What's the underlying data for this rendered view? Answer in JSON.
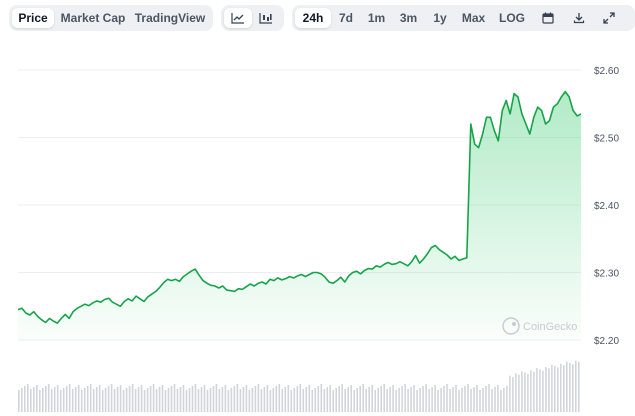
{
  "tabs": [
    {
      "label": "Price",
      "active": true
    },
    {
      "label": "Market Cap",
      "active": false
    },
    {
      "label": "TradingView",
      "active": false
    }
  ],
  "chart_type_icons": [
    {
      "icon": "line-chart-icon",
      "active": true
    },
    {
      "icon": "candlestick-chart-icon",
      "active": false
    }
  ],
  "ranges": [
    {
      "label": "24h",
      "active": true
    },
    {
      "label": "7d",
      "active": false
    },
    {
      "label": "1m",
      "active": false
    },
    {
      "label": "3m",
      "active": false
    },
    {
      "label": "1y",
      "active": false
    },
    {
      "label": "Max",
      "active": false
    },
    {
      "label": "LOG",
      "active": false
    }
  ],
  "actions": [
    {
      "icon": "calendar-icon"
    },
    {
      "icon": "download-icon"
    },
    {
      "icon": "fullscreen-icon"
    }
  ],
  "watermark": "CoinGecko",
  "colors": {
    "line": "#16a34a",
    "area": "#22c55e",
    "volume": "#d1d5db",
    "grid": "#eceef1"
  },
  "chart_data": {
    "type": "area",
    "title": "",
    "xlabel": "",
    "ylabel": "",
    "ylim": [
      2.18,
      2.62
    ],
    "yticks": [
      2.2,
      2.3,
      2.4,
      2.5,
      2.6
    ],
    "ytick_labels": [
      "$2.20",
      "$2.30",
      "$2.40",
      "$2.50",
      "$2.60"
    ],
    "grid": true,
    "x": [
      0,
      1,
      2,
      3,
      4,
      5,
      6,
      7,
      8,
      9,
      10,
      11,
      12,
      13,
      14,
      15,
      16,
      17,
      18,
      19,
      20,
      21,
      22,
      23,
      24,
      25,
      26,
      27,
      28,
      29,
      30,
      31,
      32,
      33,
      34,
      35,
      36,
      37,
      38,
      39,
      40,
      41,
      42,
      43,
      44,
      45,
      46,
      47,
      48,
      49,
      50,
      51,
      52,
      53,
      54,
      55,
      56,
      57,
      58,
      59,
      60,
      61,
      62,
      63,
      64,
      65,
      66,
      67,
      68,
      69,
      70,
      71,
      72,
      73,
      74,
      75,
      76,
      77,
      78,
      79,
      80,
      81,
      82,
      83,
      84,
      85,
      86,
      87,
      88,
      89,
      90,
      91,
      92,
      93,
      94,
      95,
      96,
      97,
      98,
      99,
      100,
      101,
      102,
      103,
      104,
      105,
      106,
      107,
      108,
      109,
      110,
      111,
      112,
      113,
      114,
      115,
      116,
      117,
      118,
      119
    ],
    "values": [
      2.245,
      2.247,
      2.24,
      2.237,
      2.242,
      2.235,
      2.23,
      2.226,
      2.232,
      2.228,
      2.225,
      2.232,
      2.238,
      2.232,
      2.242,
      2.247,
      2.25,
      2.253,
      2.251,
      2.255,
      2.258,
      2.256,
      2.26,
      2.262,
      2.256,
      2.253,
      2.25,
      2.257,
      2.261,
      2.258,
      2.265,
      2.261,
      2.257,
      2.264,
      2.268,
      2.272,
      2.278,
      2.285,
      2.29,
      2.288,
      2.29,
      2.287,
      2.294,
      2.298,
      2.302,
      2.305,
      2.296,
      2.288,
      2.284,
      2.281,
      2.28,
      2.277,
      2.28,
      2.274,
      2.273,
      2.272,
      2.276,
      2.275,
      2.279,
      2.283,
      2.28,
      2.284,
      2.286,
      2.283,
      2.29,
      2.288,
      2.292,
      2.289,
      2.291,
      2.294,
      2.292,
      2.295,
      2.297,
      2.294,
      2.297,
      2.3,
      2.3,
      2.298,
      2.293,
      2.286,
      2.284,
      2.288,
      2.293,
      2.286,
      2.295,
      2.3,
      2.302,
      2.298,
      2.303,
      2.306,
      2.305,
      2.31,
      2.308,
      2.312,
      2.315,
      2.312,
      2.313,
      2.316,
      2.313,
      2.31,
      2.316,
      2.325,
      2.314,
      2.32,
      2.328,
      2.337,
      2.34,
      2.334,
      2.33,
      2.326,
      2.32,
      2.324,
      2.318,
      2.32,
      2.322,
      2.52,
      2.49,
      2.485,
      2.505,
      2.53
    ],
    "x2": [
      0,
      1,
      2,
      3,
      4,
      5,
      6,
      7,
      8,
      9,
      10,
      11,
      12,
      13,
      14,
      15,
      16,
      17,
      18,
      19,
      20,
      21,
      22,
      23
    ],
    "values2": [
      2.53,
      2.51,
      2.495,
      2.54,
      2.555,
      2.535,
      2.565,
      2.56,
      2.535,
      2.52,
      2.505,
      2.53,
      2.545,
      2.54,
      2.52,
      2.525,
      2.545,
      2.55,
      2.56,
      2.568,
      2.56,
      2.54,
      2.532,
      2.535
    ]
  }
}
